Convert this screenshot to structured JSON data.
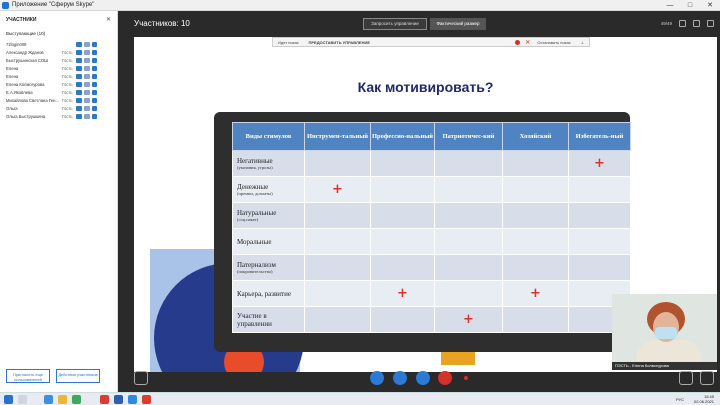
{
  "window": {
    "title": "Приложение \"Сферум Skype\"",
    "controls": [
      "—",
      "□",
      "✕"
    ]
  },
  "sidebar": {
    "heading": "УЧАСТНИКИ",
    "close": "✕",
    "section": "Выступающие (10)",
    "participants": [
      {
        "name": "72login008",
        "role": ""
      },
      {
        "name": "Александр Жданов",
        "role": "Гость"
      },
      {
        "name": "Быструшинская СОШ",
        "role": "Гость"
      },
      {
        "name": "Елена",
        "role": "Гость"
      },
      {
        "name": "Елена",
        "role": "Гость"
      },
      {
        "name": "Елена Колмогурова",
        "role": "Гость"
      },
      {
        "name": "Е.А.Яковлева",
        "role": "Гость"
      },
      {
        "name": "Михайлова Светлана Ген...",
        "role": "Гость"
      },
      {
        "name": "Ольга",
        "role": "Гость"
      },
      {
        "name": "Ольга Быструшкина",
        "role": "Гость"
      }
    ],
    "invite_button": "Пригласить еще пользователей",
    "actions_button": "Действия участников"
  },
  "topbar": {
    "participants_label": "Участников: 10",
    "request_control": "Запросить управление",
    "actual_size": "Фактический размер",
    "quality": "49/49"
  },
  "sharebar": {
    "item1": "Идет показ",
    "item2": "ПРЕДОСТАВИТЬ УПРАВЛЕНИЕ",
    "stop": "Остановить показ"
  },
  "slide": {
    "title": "Как мотивировать?",
    "columns": [
      "Виды стимулов",
      "Инструмен-тальный",
      "Профессио-нальный",
      "Патриотичес-кий",
      "Хозяйский",
      "Избегатель-ный"
    ],
    "rows": [
      {
        "label": "Негативные",
        "sub": "(указания, угрозы)",
        "marks": [
          false,
          false,
          false,
          false,
          true
        ]
      },
      {
        "label": "Денежные",
        "sub": "(премии, доплаты)",
        "marks": [
          true,
          false,
          false,
          false,
          false
        ]
      },
      {
        "label": "Натуральные",
        "sub": "(соц.пакет)",
        "marks": [
          false,
          false,
          false,
          false,
          false
        ]
      },
      {
        "label": "Моральные",
        "sub": "",
        "marks": [
          false,
          false,
          false,
          false,
          false
        ]
      },
      {
        "label": "Патернализм",
        "sub": "(покровительство)",
        "marks": [
          false,
          false,
          false,
          false,
          false
        ]
      },
      {
        "label": "Карьера, развитие",
        "sub": "",
        "marks": [
          false,
          true,
          false,
          true,
          false
        ]
      },
      {
        "label": "Участие в управлении",
        "sub": "",
        "marks": [
          false,
          false,
          true,
          false,
          false
        ]
      }
    ],
    "plus_symbol": "+"
  },
  "video": {
    "label": "ПЭСТЬ - Елена Колмогурова"
  },
  "taskbar": {
    "lang": "РУС",
    "time": "15:45",
    "date": "02.06.2021"
  },
  "colors": {
    "header_blue": "#4f83c2",
    "title_navy": "#1f2a6b",
    "plus_red": "#e0302a"
  }
}
